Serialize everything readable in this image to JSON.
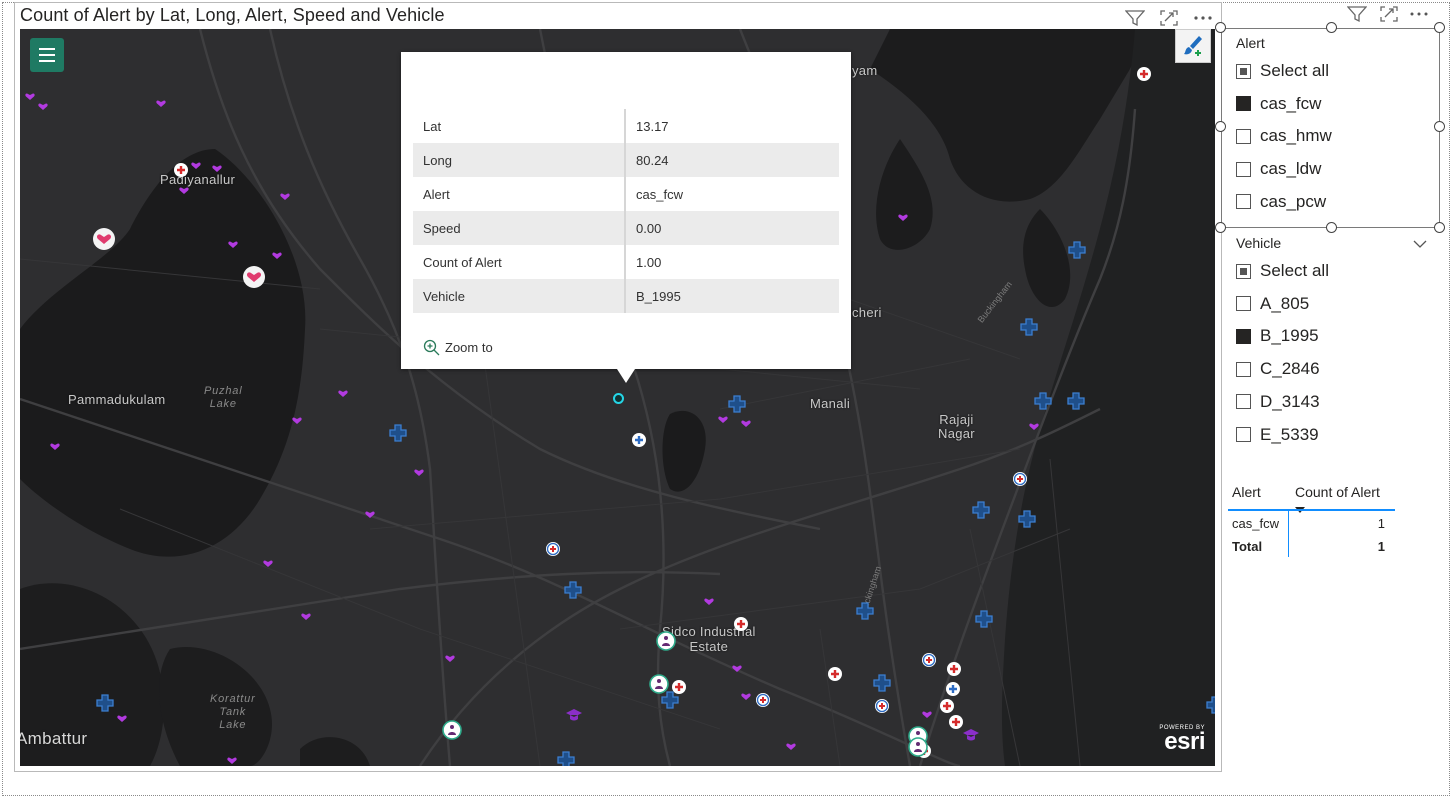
{
  "map": {
    "title": "Count of Alert by Lat, Long, Alert, Speed and Vehicle",
    "header_icons": [
      "filter-icon",
      "focus-mode-icon",
      "more-options-icon"
    ],
    "places": {
      "padiyanallur": "Padiyanallur",
      "pammadukulam": "Pammadukulam",
      "manali": "Manali",
      "rajaji_nagar": "Rajaji\nNagar",
      "sidco": "Sidco Industrial\nEstate",
      "ambattur": "Ambattur",
      "yam_fragment": "yam",
      "cheri_fragment": "cheri",
      "puzhal_lake": "Puzhal\nLake",
      "korattur_lake": "Korattur\nTank\nLake",
      "buckingham1": "Buckingham",
      "buckingham2": "Buckingham"
    },
    "esri": {
      "powered_by": "POWERED BY",
      "name": "esri"
    },
    "colors": {
      "background": "#2b2b2c",
      "selected_point": "#25d6e6",
      "hospital_red": "#d52b2b",
      "clinic_blue": "#2d6cc4",
      "health_purple": "#a43ed6"
    }
  },
  "popup": {
    "rows": [
      {
        "label": "Lat",
        "value": "13.17"
      },
      {
        "label": "Long",
        "value": "80.24"
      },
      {
        "label": "Alert",
        "value": "cas_fcw"
      },
      {
        "label": "Speed",
        "value": "0.00"
      },
      {
        "label": "Count of Alert",
        "value": "1.00"
      },
      {
        "label": "Vehicle",
        "value": "B_1995"
      }
    ],
    "zoom_label": "Zoom to"
  },
  "alert_slicer": {
    "title": "Alert",
    "items": [
      {
        "label": "Select all",
        "state": "partial"
      },
      {
        "label": "cas_fcw",
        "state": "checked"
      },
      {
        "label": "cas_hmw",
        "state": "unchecked"
      },
      {
        "label": "cas_ldw",
        "state": "unchecked"
      },
      {
        "label": "cas_pcw",
        "state": "unchecked"
      }
    ]
  },
  "vehicle_slicer": {
    "title": "Vehicle",
    "items": [
      {
        "label": "Select all",
        "state": "partial"
      },
      {
        "label": "A_805",
        "state": "unchecked"
      },
      {
        "label": "B_1995",
        "state": "checked"
      },
      {
        "label": "C_2846",
        "state": "unchecked"
      },
      {
        "label": "D_3143",
        "state": "unchecked"
      },
      {
        "label": "E_5339",
        "state": "unchecked"
      }
    ]
  },
  "table": {
    "col1": "Alert",
    "col2": "Count of Alert",
    "rows": [
      {
        "alert": "cas_fcw",
        "count": "1"
      }
    ],
    "total_label": "Total",
    "total_value": "1"
  }
}
